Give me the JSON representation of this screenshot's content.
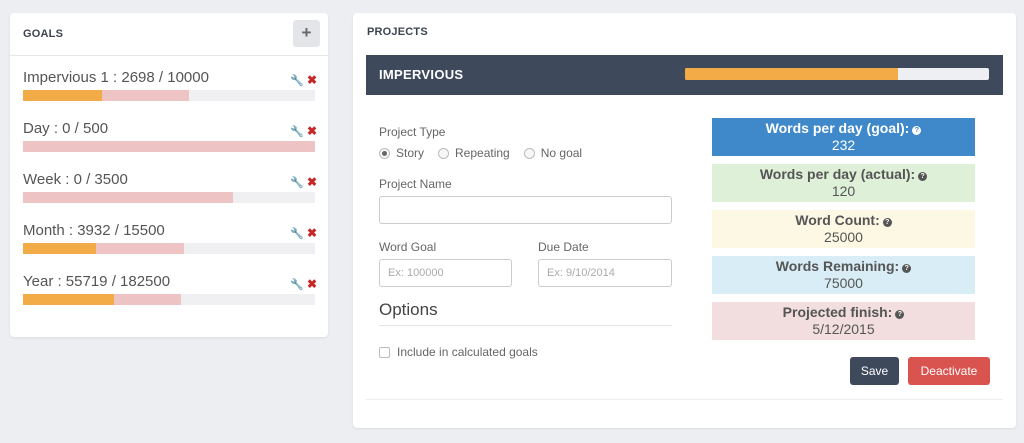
{
  "goals": {
    "title": "GOALS",
    "add_label": "+",
    "items": [
      {
        "label": "Impervious 1 : 2698 / 10000",
        "primary_fraction": 0.27,
        "secondary_fraction": 0.57
      },
      {
        "label": "Day : 0 / 500",
        "primary_fraction": 0.0,
        "secondary_fraction": 1.0
      },
      {
        "label": "Week : 0 / 3500",
        "primary_fraction": 0.0,
        "secondary_fraction": 0.72
      },
      {
        "label": "Month : 3932 / 15500",
        "primary_fraction": 0.25,
        "secondary_fraction": 0.55
      },
      {
        "label": "Year : 55719 / 182500",
        "primary_fraction": 0.31,
        "secondary_fraction": 0.54
      }
    ],
    "edit_icon": "wrench-icon",
    "delete_icon": "close-icon",
    "edit_glyph": "🔧",
    "delete_glyph": "✖"
  },
  "projects": {
    "title": "PROJECTS",
    "project": {
      "name": "IMPERVIOUS",
      "progress_fraction": 0.7,
      "project_type_label": "Project Type",
      "types": [
        "Story",
        "Repeating",
        "No goal"
      ],
      "selected_type": "Story",
      "project_name_label": "Project Name",
      "project_name_value": "",
      "word_goal_label": "Word Goal",
      "word_goal_placeholder": "Ex: 100000",
      "due_date_label": "Due Date",
      "due_date_placeholder": "Ex: 9/10/2014",
      "options_title": "Options",
      "include_label": "Include in calculated goals",
      "include_checked": false,
      "stats": {
        "goal_title": "Words per day (goal):",
        "goal_value": "232",
        "actual_title": "Words per day (actual):",
        "actual_value": "120",
        "count_title": "Word Count:",
        "count_value": "25000",
        "remaining_title": "Words Remaining:",
        "remaining_value": "75000",
        "finish_title": "Projected finish:",
        "finish_value": "5/12/2015"
      },
      "help_glyph": "?",
      "save_label": "Save",
      "deactivate_label": "Deactivate"
    }
  },
  "colors": {
    "accent_orange": "#f2ab47",
    "bar_pink": "#eec3c4",
    "header_dark": "#3e4a5c",
    "danger": "#d9534f",
    "stat_blue": "#3f88c9"
  }
}
